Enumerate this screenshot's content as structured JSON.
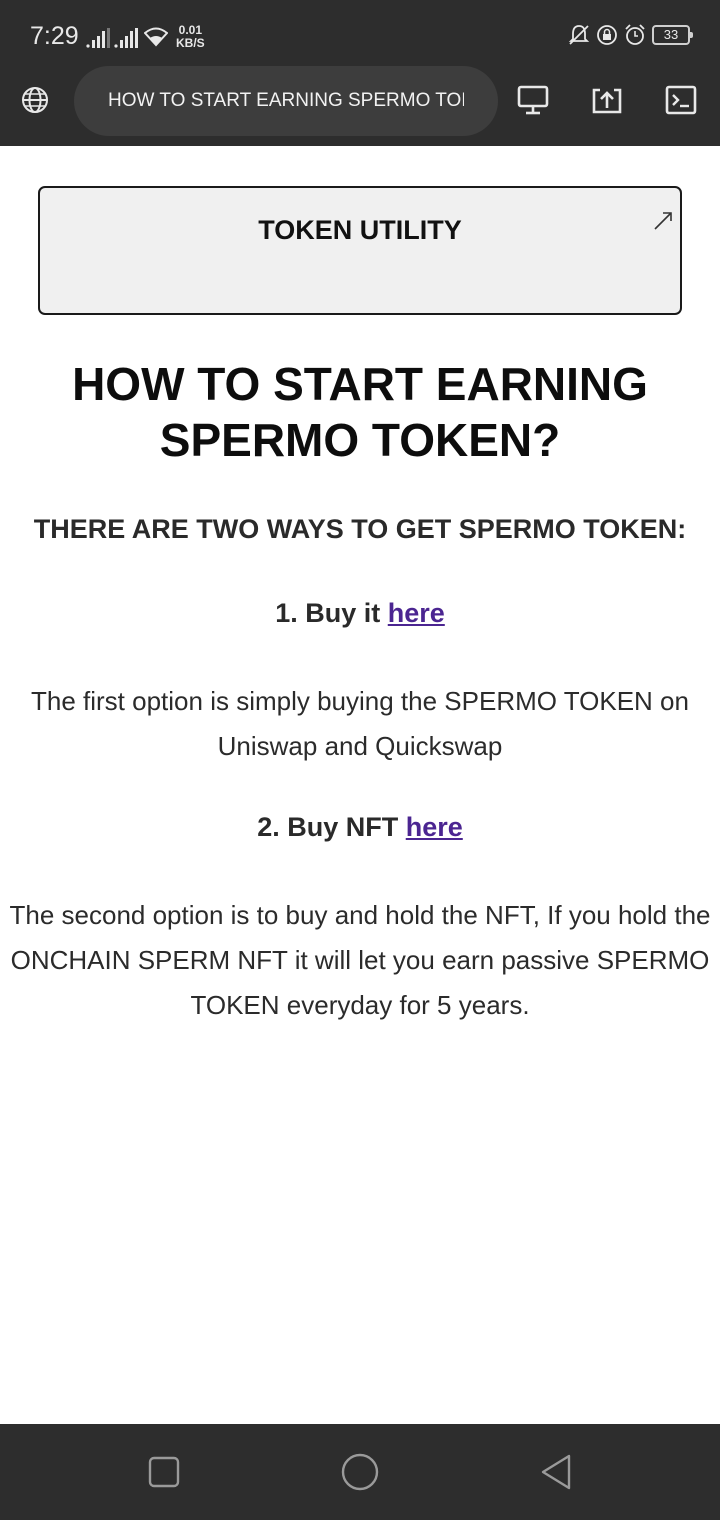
{
  "status_bar": {
    "time": "7:29",
    "net_speed_value": "0.01",
    "net_speed_unit": "KB/S",
    "battery_level": "33",
    "icons": [
      "signal-icon",
      "signal-icon",
      "wifi-icon",
      "mute-icon",
      "lock-rotation-icon",
      "alarm-icon",
      "battery-icon"
    ]
  },
  "toolbar": {
    "url_text": "HOW TO START EARNING SPERMO TOKEN?",
    "icons": [
      "globe-icon",
      "desktop-icon",
      "share-icon",
      "terminal-icon"
    ]
  },
  "page": {
    "card_title": "TOKEN UTILITY",
    "heading": "HOW TO START EARNING SPERMO TOKEN?",
    "subheading": "THERE ARE TWO WAYS TO GET SPERMO TOKEN:",
    "option1_prefix": "1. Buy it",
    "option1_link": "here",
    "option1_text": "The first option is simply buying the SPERMO TOKEN on Uniswap and Quickswap",
    "option2_prefix": "2. Buy NFT",
    "option2_link": "here",
    "option2_text": "The second option is to buy and hold the NFT, If you hold the ONCHAIN SPERM NFT it will let you earn passive SPERMO TOKEN everyday for 5 years."
  },
  "nav_bar": {
    "icons": [
      "recents-icon",
      "home-icon",
      "back-icon"
    ]
  },
  "colors": {
    "chrome": "#2d2d2d",
    "url_bar": "#3d3d3d",
    "link": "#4b2591",
    "card_bg": "#f0f0f0"
  }
}
